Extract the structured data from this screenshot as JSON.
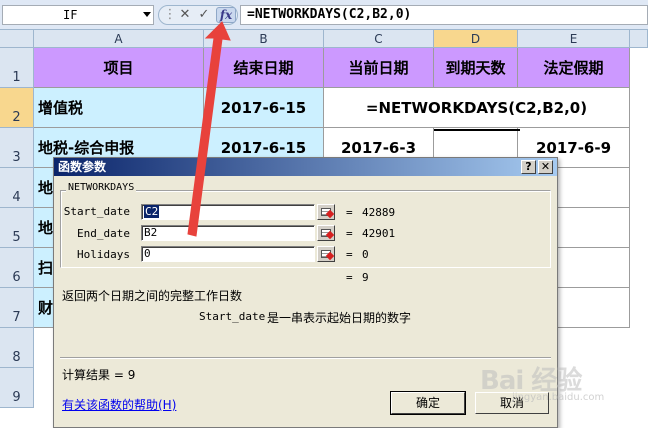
{
  "formula_bar": {
    "name_box": "IF",
    "cancel_symbol": "✕",
    "enter_symbol": "✓",
    "fx_symbol": "fx",
    "formula": "=NETWORKDAYS(C2,B2,0)"
  },
  "columns": [
    "A",
    "B",
    "C",
    "D",
    "E"
  ],
  "active_column": "D",
  "rows": [
    "1",
    "2",
    "3",
    "4",
    "5",
    "6",
    "7",
    "8",
    "9"
  ],
  "active_row": "2",
  "table": {
    "headers": [
      "项目",
      "结束日期",
      "当前日期",
      "到期天数",
      "法定假期"
    ],
    "row2": {
      "item": "增值税",
      "end_date": "2017-6-15",
      "formula_text": "=NETWORKDAYS(C2,B2,0)"
    },
    "row3": {
      "item": "地税-综合申报",
      "end_date": "2017-6-15",
      "current_date": "2017-6-3",
      "holiday": "2017-6-9"
    },
    "row4": {
      "item": "地"
    },
    "row5": {
      "item": "地"
    },
    "row6": {
      "item": "扫"
    },
    "row7": {
      "item": "财"
    }
  },
  "dialog": {
    "title": "函数参数",
    "help_symbol": "?",
    "close_symbol": "✕",
    "function_name": "NETWORKDAYS",
    "args": [
      {
        "label": "Start_date",
        "value": "C2",
        "result": "42889"
      },
      {
        "label": "End_date",
        "value": "B2",
        "result": "42901"
      },
      {
        "label": "Holidays",
        "value": "0",
        "result": "0"
      }
    ],
    "eq_symbol": "=",
    "function_result": "9",
    "function_description": "返回两个日期之间的完整工作日数",
    "arg_description_name": "Start_date",
    "arg_description": "是一串表示起始日期的数字",
    "calc_result_label": "计算结果 = ",
    "calc_result_value": "9",
    "help_link": "有关该函数的帮助(H)",
    "ok_label": "确定",
    "cancel_label": "取消"
  },
  "watermark": {
    "main": "Bai 经验",
    "sub": "jingyan.baidu.com"
  },
  "colors": {
    "header_fill": "#cc99ff",
    "blue_fill": "#ccf0ff",
    "arrow": "#e8423c",
    "title_bar": "#0a246a"
  }
}
